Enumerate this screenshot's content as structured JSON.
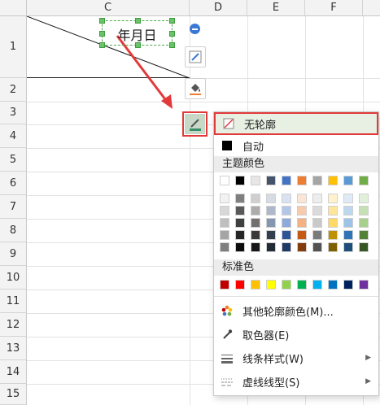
{
  "columns": [
    "C",
    "D",
    "E",
    "F"
  ],
  "rows": [
    "1",
    "2",
    "3",
    "4",
    "5",
    "6",
    "7",
    "8",
    "9",
    "10",
    "11",
    "12",
    "13",
    "14",
    "15"
  ],
  "textbox": {
    "text": "年月日"
  },
  "menu": {
    "no_outline": "无轮廓",
    "auto": "自动",
    "theme_colors_label": "主题颜色",
    "standard_colors_label": "标准色",
    "more_colors": "其他轮廓颜色(M)...",
    "eyedropper": "取色器(E)",
    "line_style": "线条样式(W)",
    "dash_style": "虚线线型(S)"
  },
  "theme_colors": {
    "top": [
      "#ffffff",
      "#000000",
      "#e7e6e6",
      "#44546a",
      "#4472c4",
      "#ed7d31",
      "#a5a5a5",
      "#ffc000",
      "#5b9bd5",
      "#70ad47"
    ],
    "shades": [
      [
        "#f2f2f2",
        "#7f7f7f",
        "#d0cece",
        "#d6dce4",
        "#d9e2f3",
        "#fbe5d5",
        "#ededed",
        "#fff2cc",
        "#deebf6",
        "#e2efd9"
      ],
      [
        "#d8d8d8",
        "#595959",
        "#aeabab",
        "#adb9ca",
        "#b4c6e7",
        "#f7cbac",
        "#dbdbdb",
        "#fee599",
        "#bdd7ee",
        "#c5e0b3"
      ],
      [
        "#bfbfbf",
        "#3f3f3f",
        "#757070",
        "#8496b0",
        "#8eaadb",
        "#f4b183",
        "#c9c9c9",
        "#ffd965",
        "#9dc3e6",
        "#a8d08d"
      ],
      [
        "#a5a5a5",
        "#262626",
        "#3a3838",
        "#323f4f",
        "#2f5496",
        "#c55a11",
        "#7b7b7b",
        "#bf9000",
        "#2e75b5",
        "#538135"
      ],
      [
        "#7f7f7f",
        "#0c0c0c",
        "#171616",
        "#222a35",
        "#1f3864",
        "#833c0b",
        "#525252",
        "#7f6000",
        "#1e4e79",
        "#375623"
      ]
    ]
  },
  "standard_colors": [
    "#c00000",
    "#ff0000",
    "#ffc000",
    "#ffff00",
    "#92d050",
    "#00b050",
    "#00b0f0",
    "#0070c0",
    "#002060",
    "#7030a0"
  ],
  "colors": {
    "highlight_border": "#e23a3a",
    "handle_green": "#6ac26a",
    "accent_blue": "#3b78d6"
  }
}
